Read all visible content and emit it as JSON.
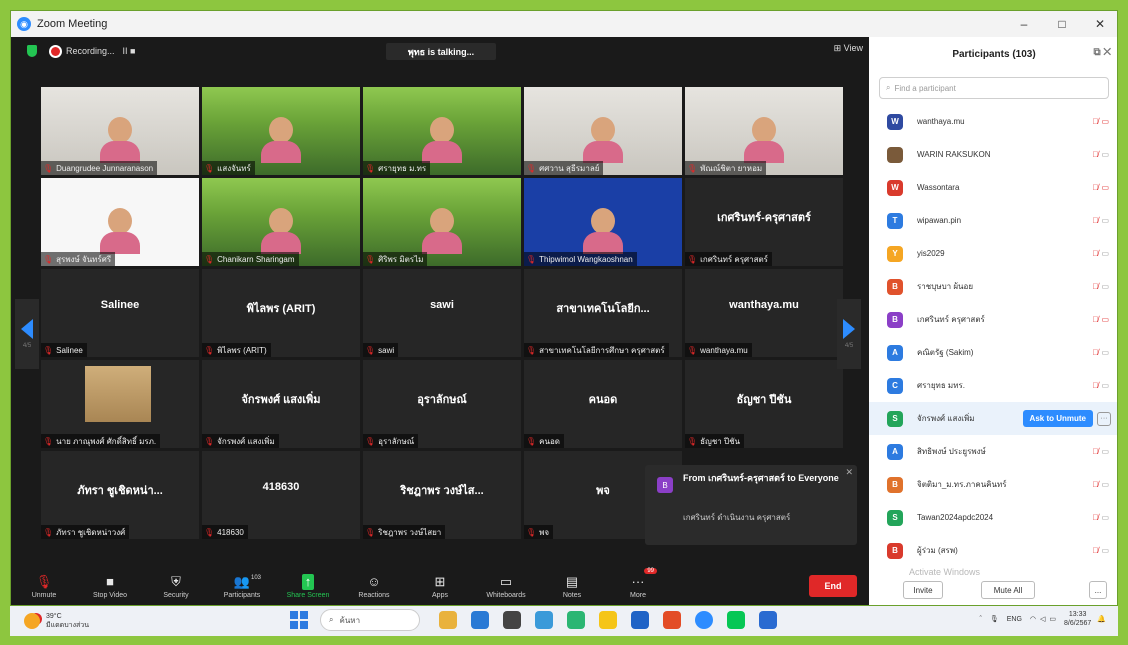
{
  "window": {
    "title": "Zoom Meeting",
    "controls": [
      "–",
      "□",
      "✕"
    ]
  },
  "topbar": {
    "recording_label": "Recording...",
    "recording_controls": "II ■",
    "talking": "พุทธ is talking...",
    "view_label": "⊞ View"
  },
  "tiles": [
    {
      "type": "video",
      "bg": "office",
      "name": "Duangrudee Junnaranason"
    },
    {
      "type": "video",
      "bg": "forest",
      "name": "แสงจันทร์"
    },
    {
      "type": "video",
      "bg": "forest",
      "name": "ศรายุทธ ม.ทร"
    },
    {
      "type": "video",
      "bg": "office",
      "name": "ศศวาน สุธีรมาลย์"
    },
    {
      "type": "video",
      "bg": "office",
      "name": "พัณณ์ชิตา ยาหอม"
    },
    {
      "type": "video",
      "bg": "white",
      "name": "สุรพงษ์ จันทร์ศรี"
    },
    {
      "type": "video",
      "bg": "forest",
      "name": "Chanikarn Sharingam"
    },
    {
      "type": "video",
      "bg": "forest",
      "name": "ศิริพร มิตรไม"
    },
    {
      "type": "video",
      "bg": "blue",
      "name": "Thipwimol Wangkaoshnan"
    },
    {
      "type": "name",
      "display": "เกศรินทร์-ครุศาสตร์",
      "name": "เกศรินทร์ ครุศาสตร์"
    },
    {
      "type": "name",
      "display": "Salinee",
      "name": "Salinee"
    },
    {
      "type": "name",
      "display": "พิไลพร (ARIT)",
      "name": "พิไลพร (ARIT)"
    },
    {
      "type": "name",
      "display": "sawi",
      "name": "sawi"
    },
    {
      "type": "name",
      "display": "สาขาเทคโนโลยีก...",
      "name": "สาขาเทคโนโลยีการศึกษา ครุศาสตร์"
    },
    {
      "type": "name",
      "display": "wanthaya.mu",
      "name": "wanthaya.mu"
    },
    {
      "type": "thumb",
      "bg": "room",
      "name": "นาย ภาณุพงศ์ ศักดิ์สิทธิ์ มรภ."
    },
    {
      "type": "name",
      "display": "จักรพงศ์ แสงเพิ่ม",
      "name": "จักรพงศ์ แสงเพิ่ม"
    },
    {
      "type": "name",
      "display": "อุราลักษณ์",
      "name": "อุราลักษณ์"
    },
    {
      "type": "name",
      "display": "คนอด",
      "name": "คนอด"
    },
    {
      "type": "name",
      "display": "ธัญชา ปีชัน",
      "name": "ธัญชา ปีชัน"
    },
    {
      "type": "name",
      "display": "ภัทรา ชูเชิดหน่า...",
      "name": "ภัทรา ชูเชิดหน่าวงศ์"
    },
    {
      "type": "name",
      "display": "418630",
      "name": "418630"
    },
    {
      "type": "name",
      "display": "ริชฎาพร วงษ์ไส...",
      "name": "ริชฎาพร วงษ์ไสยา"
    },
    {
      "type": "name",
      "display": "พจ",
      "name": "พจ"
    }
  ],
  "nav": {
    "left_page": "4/5",
    "right_page": "4/5"
  },
  "chat_popup": {
    "from": "From เกศรินทร์-ครุศาสตร์ to Everyone",
    "message": "เกศรินทร์ ดำเนินงาน ครุศาสตร์",
    "close": "✕"
  },
  "toolbar": {
    "unmute": "Unmute",
    "stop_video": "Stop Video",
    "security": "Security",
    "participants": "Participants",
    "participants_count": "103",
    "share_screen": "Share Screen",
    "reactions": "Reactions",
    "apps": "Apps",
    "whiteboards": "Whiteboards",
    "notes": "Notes",
    "more": "More",
    "more_badge": "99",
    "end": "End"
  },
  "panel": {
    "title": "Participants (103)",
    "search_placeholder": "Find a participant",
    "participants": [
      {
        "initial": "W",
        "color": "#2f4aa1",
        "name": "wanthaya.mu",
        "cam_red": true
      },
      {
        "initial": "",
        "color": "#7a5a3a",
        "name": "WARIN RAKSUKON",
        "cam_red": false
      },
      {
        "initial": "W",
        "color": "#d93a2c",
        "name": "Wassontara",
        "cam_red": true
      },
      {
        "initial": "T",
        "color": "#2d7be0",
        "name": "wipawan.pin",
        "cam_red": false
      },
      {
        "initial": "Y",
        "color": "#f5a623",
        "name": "yis2029",
        "cam_red": false
      },
      {
        "initial": "B",
        "color": "#e0522c",
        "name": "ราชบุษบา ผ้นอย",
        "cam_red": false
      },
      {
        "initial": "B",
        "color": "#8b3fc7",
        "name": "เกศรินทร์ ครุศาสตร์",
        "cam_red": true
      },
      {
        "initial": "A",
        "color": "#2d7be0",
        "name": "คณิตรัฐ (Sakim)",
        "cam_red": false
      },
      {
        "initial": "C",
        "color": "#2d7be0",
        "name": "ศรายุทธ มทร.",
        "cam_red": false
      },
      {
        "initial": "S",
        "color": "#23a55a",
        "name": "จักรพงศ์ แสงเพิ่ม",
        "cam_red": false,
        "highlight": true,
        "action": "Ask to Unmute"
      },
      {
        "initial": "A",
        "color": "#2d7be0",
        "name": "สิทธิพงษ์ ประยูรพงษ์",
        "cam_red": false
      },
      {
        "initial": "B",
        "color": "#e0722c",
        "name": "จิตติมา_ม.ทร.ภาคนคินทร์",
        "cam_red": false
      },
      {
        "initial": "S",
        "color": "#23a55a",
        "name": "Tawan2024apdc2024",
        "cam_red": false
      },
      {
        "initial": "B",
        "color": "#d93a2c",
        "name": "ผู้ร่วม (สรพ)",
        "cam_red": false
      }
    ],
    "invite": "Invite",
    "mute_all": "Mute All",
    "more": "...",
    "watermark": "Activate Windows"
  },
  "taskbar": {
    "temp": "39°C",
    "weather": "มีแดดบางส่วน",
    "search": "ค้นหา",
    "lang": "ENG",
    "time": "13:33",
    "date": "8/6/2567"
  }
}
